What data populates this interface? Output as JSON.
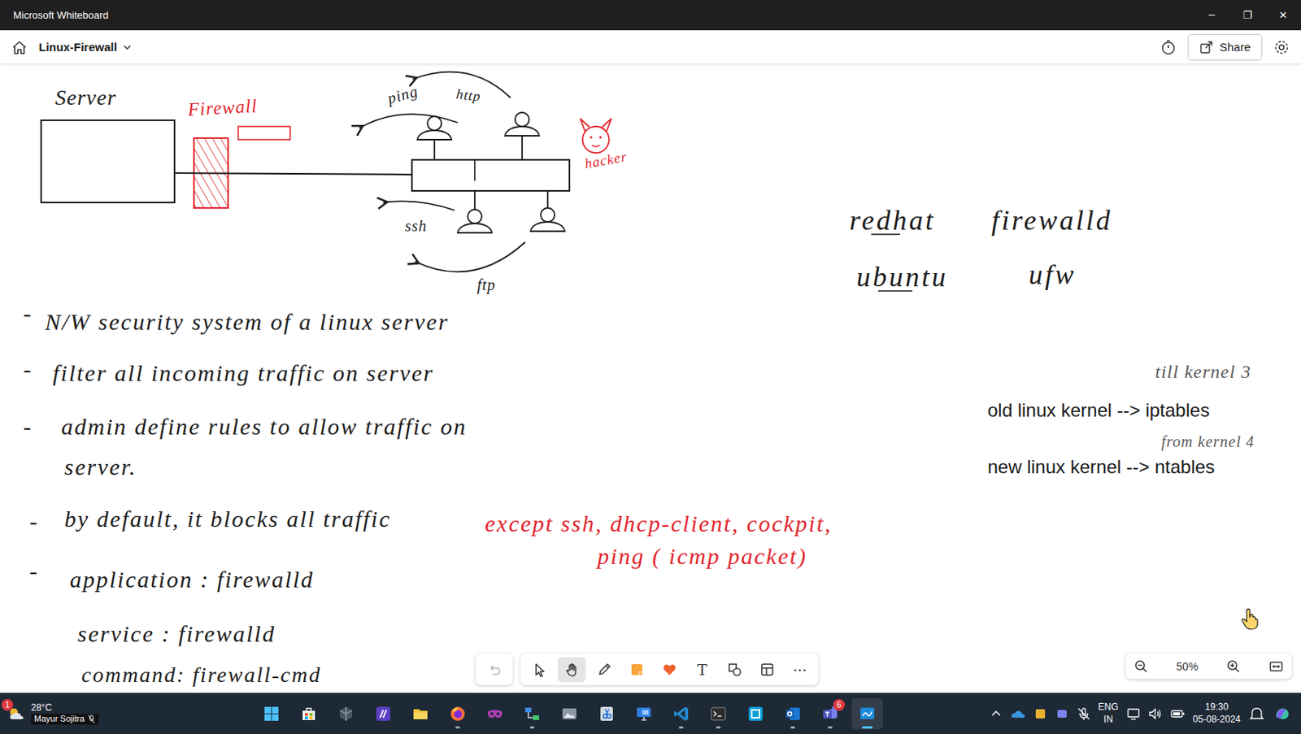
{
  "window": {
    "title": "Microsoft Whiteboard",
    "controls": [
      "─",
      "❐",
      "✕"
    ]
  },
  "header": {
    "board_name": "Linux-Firewall",
    "share_label": "Share"
  },
  "canvas": {
    "diagram_labels": [
      {
        "text": "Server",
        "color": "#1c1c1c"
      },
      {
        "text": "Firewall",
        "color": "#e3262e"
      },
      {
        "text": "ping",
        "color": "#1c1c1c"
      },
      {
        "text": "http",
        "color": "#1c1c1c"
      },
      {
        "text": "ssh",
        "color": "#1c1c1c"
      },
      {
        "text": "ftp",
        "color": "#1c1c1c"
      },
      {
        "text": "hacker",
        "color": "#e3262e"
      }
    ],
    "distros": [
      {
        "distro": "redhat",
        "firewall": "firewalld"
      },
      {
        "distro": "ubuntu",
        "firewall": "ufw"
      }
    ],
    "notes": [
      {
        "text": "-",
        "color": "#1c1c1c"
      },
      {
        "text": "N/W security system of a linux server",
        "color": "#1c1c1c"
      },
      {
        "text": "-",
        "color": "#1c1c1c"
      },
      {
        "text": "filter all incoming traffic on server",
        "color": "#1c1c1c"
      },
      {
        "text": "-",
        "color": "#1c1c1c"
      },
      {
        "text": "admin define rules to allow traffic on",
        "color": "#1c1c1c"
      },
      {
        "text": "server.",
        "color": "#1c1c1c"
      },
      {
        "text": "-",
        "color": "#1c1c1c"
      },
      {
        "text": "by default, it blocks all traffic",
        "color": "#1c1c1c"
      },
      {
        "text": "except ssh, dhcp-client, cockpit,",
        "color": "#e3262e"
      },
      {
        "text": "ping ( icmp packet)",
        "color": "#e3262e"
      },
      {
        "text": "-",
        "color": "#1c1c1c"
      },
      {
        "text": "application : firewalld",
        "color": "#1c1c1c"
      },
      {
        "text": "service : firewalld",
        "color": "#1c1c1c"
      },
      {
        "text": "command: firewall-cmd",
        "color": "#1c1c1c"
      }
    ],
    "kernel_notes": [
      {
        "text": "till kernel 3",
        "kind": "handwritten",
        "color": "#5a5a5a"
      },
      {
        "text": "old linux kernel --> iptables",
        "kind": "typed",
        "color": "#1a1a1a"
      },
      {
        "text": "from kernel 4",
        "kind": "handwritten",
        "color": "#5a5a5a"
      },
      {
        "text": "new linux kernel --> ntables",
        "kind": "typed",
        "color": "#1a1a1a"
      }
    ]
  },
  "toolbar": {
    "tools": [
      {
        "kind": "undo",
        "selected": false,
        "disabled": true
      },
      {
        "kind": "select",
        "selected": false,
        "disabled": false
      },
      {
        "kind": "hand",
        "selected": true,
        "disabled": false
      },
      {
        "kind": "pen",
        "selected": false,
        "disabled": false
      },
      {
        "kind": "sticky",
        "selected": false,
        "disabled": false
      },
      {
        "kind": "reaction",
        "selected": false,
        "disabled": false
      },
      {
        "kind": "text",
        "selected": false,
        "disabled": false,
        "glyph": "T"
      },
      {
        "kind": "shapes",
        "selected": false,
        "disabled": false
      },
      {
        "kind": "template",
        "selected": false,
        "disabled": false
      },
      {
        "kind": "more",
        "selected": false,
        "disabled": false,
        "glyph": "···"
      }
    ]
  },
  "zoom": {
    "label": "50%"
  },
  "taskbar": {
    "weather": "28°C",
    "weather_badge": "1",
    "user": "Mayur Sojitra",
    "apps": [
      {
        "kind": "start",
        "running": false,
        "active": false
      },
      {
        "kind": "store",
        "running": false,
        "active": false
      },
      {
        "kind": "unity",
        "running": false,
        "active": false
      },
      {
        "kind": "studio",
        "running": false,
        "active": false
      },
      {
        "kind": "explorer",
        "running": false,
        "active": false
      },
      {
        "kind": "firefox",
        "running": true,
        "active": false
      },
      {
        "kind": "vpn",
        "running": false,
        "active": false
      },
      {
        "kind": "network",
        "running": true,
        "active": false
      },
      {
        "kind": "photos",
        "running": false,
        "active": false
      },
      {
        "kind": "snip",
        "running": false,
        "active": false
      },
      {
        "kind": "remote",
        "running": false,
        "active": false
      },
      {
        "kind": "vscode",
        "running": true,
        "active": false
      },
      {
        "kind": "terminal",
        "running": true,
        "active": false
      },
      {
        "kind": "devbox",
        "running": false,
        "active": false
      },
      {
        "kind": "outlook",
        "running": true,
        "active": false
      },
      {
        "kind": "teams",
        "running": true,
        "active": false,
        "badge": "6"
      },
      {
        "kind": "whiteboard",
        "running": true,
        "active": true
      }
    ],
    "language": "ENG",
    "region": "IN",
    "time": "19:30",
    "date": "05-08-2024"
  }
}
